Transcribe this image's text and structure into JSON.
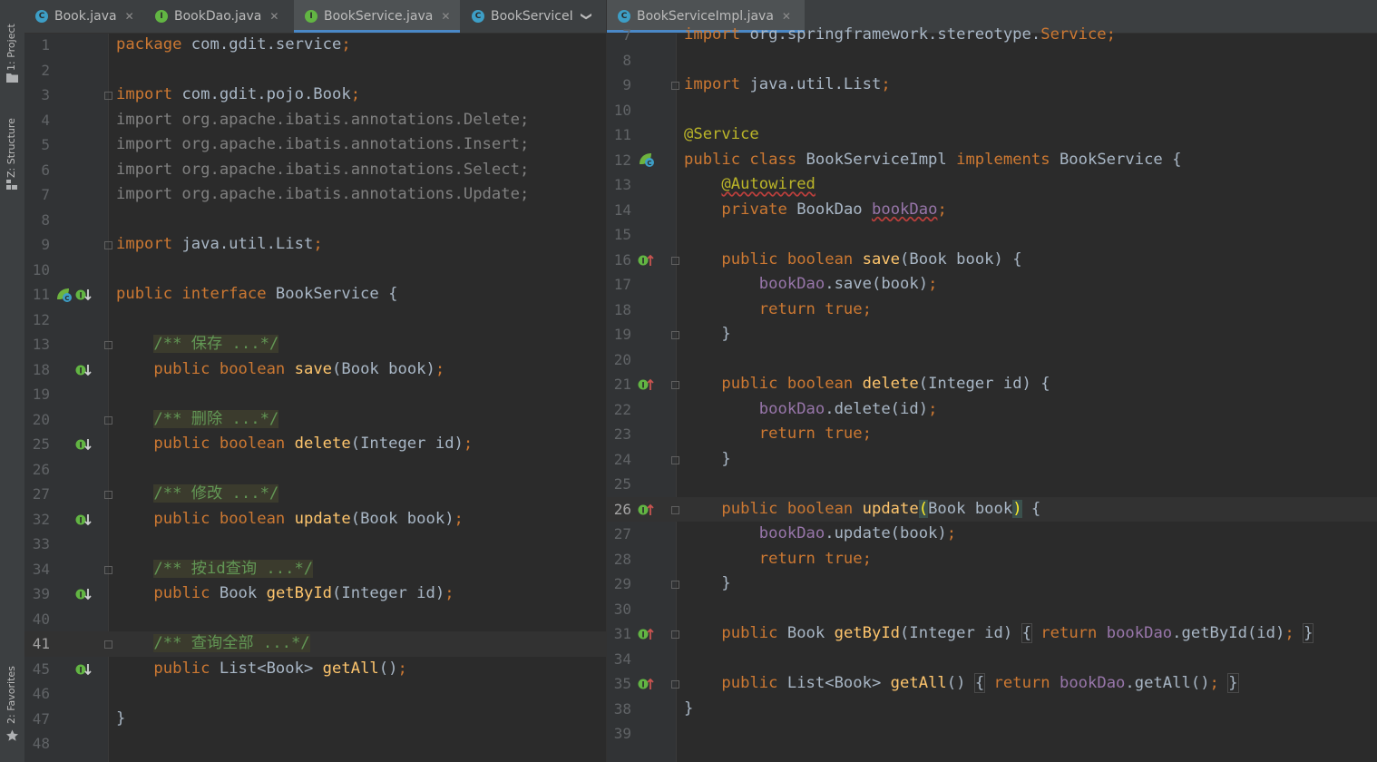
{
  "toolwindows": {
    "project": "1: Project",
    "structure": "Z: Structure",
    "favorites": "2: Favorites"
  },
  "left_tabs": [
    {
      "label": "Book.java",
      "kind": "C"
    },
    {
      "label": "BookDao.java",
      "kind": "I"
    },
    {
      "label": "BookService.java",
      "kind": "I"
    },
    {
      "label": "BookServiceI",
      "kind": "C"
    }
  ],
  "right_tabs": [
    {
      "label": "BookServiceImpl.java",
      "kind": "C"
    }
  ],
  "left_lines": [
    {
      "n": "1",
      "t": [
        [
          "kw",
          "package "
        ],
        [
          "",
          "com.gdit.service"
        ],
        [
          "kw",
          ";"
        ]
      ]
    },
    {
      "n": "2",
      "t": []
    },
    {
      "n": "3",
      "t": [
        [
          "kw",
          "import "
        ],
        [
          "",
          "com.gdit.pojo.Book"
        ],
        [
          "kw",
          ";"
        ]
      ]
    },
    {
      "n": "4",
      "t": [
        [
          "gray",
          "import org.apache.ibatis.annotations.Delete;"
        ]
      ]
    },
    {
      "n": "5",
      "t": [
        [
          "gray",
          "import org.apache.ibatis.annotations.Insert;"
        ]
      ]
    },
    {
      "n": "6",
      "t": [
        [
          "gray",
          "import org.apache.ibatis.annotations.Select;"
        ]
      ]
    },
    {
      "n": "7",
      "t": [
        [
          "gray",
          "import org.apache.ibatis.annotations.Update;"
        ]
      ]
    },
    {
      "n": "8",
      "t": []
    },
    {
      "n": "9",
      "t": [
        [
          "kw",
          "import "
        ],
        [
          "",
          "java.util.List"
        ],
        [
          "kw",
          ";"
        ]
      ]
    },
    {
      "n": "10",
      "t": []
    },
    {
      "n": "11",
      "t": [
        [
          "kw",
          "public interface "
        ],
        [
          "",
          "BookService {"
        ]
      ]
    },
    {
      "n": "12",
      "t": []
    },
    {
      "n": "13",
      "t": [
        [
          "",
          "    "
        ],
        [
          "doc",
          "/** 保存 ...*/"
        ]
      ]
    },
    {
      "n": "18",
      "t": [
        [
          "",
          "    "
        ],
        [
          "kw",
          "public boolean "
        ],
        [
          "fn",
          "save"
        ],
        [
          "",
          "(Book book)"
        ],
        [
          "kw",
          ";"
        ]
      ]
    },
    {
      "n": "19",
      "t": []
    },
    {
      "n": "20",
      "t": [
        [
          "",
          "    "
        ],
        [
          "doc",
          "/** 删除 ...*/"
        ]
      ]
    },
    {
      "n": "25",
      "t": [
        [
          "",
          "    "
        ],
        [
          "kw",
          "public boolean "
        ],
        [
          "fn",
          "delete"
        ],
        [
          "",
          "(Integer id)"
        ],
        [
          "kw",
          ";"
        ]
      ]
    },
    {
      "n": "26",
      "t": []
    },
    {
      "n": "27",
      "t": [
        [
          "",
          "    "
        ],
        [
          "doc",
          "/** 修改 ...*/"
        ]
      ]
    },
    {
      "n": "32",
      "t": [
        [
          "",
          "    "
        ],
        [
          "kw",
          "public boolean "
        ],
        [
          "fn",
          "update"
        ],
        [
          "",
          "(Book book)"
        ],
        [
          "kw",
          ";"
        ]
      ]
    },
    {
      "n": "33",
      "t": []
    },
    {
      "n": "34",
      "t": [
        [
          "",
          "    "
        ],
        [
          "doc",
          "/** 按id查询 ...*/"
        ]
      ]
    },
    {
      "n": "39",
      "t": [
        [
          "",
          "    "
        ],
        [
          "kw",
          "public "
        ],
        [
          "",
          "Book "
        ],
        [
          "fn",
          "getById"
        ],
        [
          "",
          "(Integer id)"
        ],
        [
          "kw",
          ";"
        ]
      ]
    },
    {
      "n": "40",
      "t": []
    },
    {
      "n": "41",
      "t": [
        [
          "",
          "    "
        ],
        [
          "doc",
          "/** 查询全部 ...*/"
        ]
      ]
    },
    {
      "n": "45",
      "t": [
        [
          "",
          "    "
        ],
        [
          "kw",
          "public "
        ],
        [
          "",
          "List<Book> "
        ],
        [
          "fn",
          "getAll"
        ],
        [
          "",
          "()"
        ],
        [
          "kw",
          ";"
        ]
      ]
    },
    {
      "n": "46",
      "t": []
    },
    {
      "n": "47",
      "t": [
        [
          "",
          "}"
        ]
      ]
    },
    {
      "n": "48",
      "t": []
    }
  ],
  "right_lines": [
    {
      "n": "7",
      "t": [
        [
          "kw",
          "import "
        ],
        [
          "",
          "org.springframework.stereotype."
        ],
        [
          "kw",
          "Service;"
        ]
      ]
    },
    {
      "n": "8",
      "t": []
    },
    {
      "n": "9",
      "t": [
        [
          "kw",
          "import "
        ],
        [
          "",
          "java.util.List"
        ],
        [
          "kw",
          ";"
        ]
      ]
    },
    {
      "n": "10",
      "t": []
    },
    {
      "n": "11",
      "t": [
        [
          "an",
          "@Service"
        ]
      ]
    },
    {
      "n": "12",
      "t": [
        [
          "kw",
          "public class "
        ],
        [
          "",
          "BookServiceImpl "
        ],
        [
          "kw",
          "implements "
        ],
        [
          "",
          "BookService {"
        ]
      ]
    },
    {
      "n": "13",
      "t": [
        [
          "",
          "    "
        ],
        [
          "an squig",
          "@Autowired"
        ]
      ]
    },
    {
      "n": "14",
      "t": [
        [
          "",
          "    "
        ],
        [
          "kw",
          "private "
        ],
        [
          "",
          "BookDao "
        ],
        [
          "fld squig",
          "bookDao"
        ],
        [
          "kw",
          ";"
        ]
      ]
    },
    {
      "n": "15",
      "t": []
    },
    {
      "n": "16",
      "t": [
        [
          "",
          "    "
        ],
        [
          "kw",
          "public boolean "
        ],
        [
          "fn",
          "save"
        ],
        [
          "",
          "(Book book) {"
        ]
      ]
    },
    {
      "n": "17",
      "t": [
        [
          "",
          "        "
        ],
        [
          "fld",
          "bookDao"
        ],
        [
          "",
          ".save(book)"
        ],
        [
          "kw",
          ";"
        ]
      ]
    },
    {
      "n": "18",
      "t": [
        [
          "",
          "        "
        ],
        [
          "kw",
          "return true;"
        ]
      ]
    },
    {
      "n": "19",
      "t": [
        [
          "",
          "    }"
        ]
      ]
    },
    {
      "n": "20",
      "t": []
    },
    {
      "n": "21",
      "t": [
        [
          "",
          "    "
        ],
        [
          "kw",
          "public boolean "
        ],
        [
          "fn",
          "delete"
        ],
        [
          "",
          "(Integer id) {"
        ]
      ]
    },
    {
      "n": "22",
      "t": [
        [
          "",
          "        "
        ],
        [
          "fld",
          "bookDao"
        ],
        [
          "",
          ".delete(id)"
        ],
        [
          "kw",
          ";"
        ]
      ]
    },
    {
      "n": "23",
      "t": [
        [
          "",
          "        "
        ],
        [
          "kw",
          "return true;"
        ]
      ]
    },
    {
      "n": "24",
      "t": [
        [
          "",
          "    }"
        ]
      ]
    },
    {
      "n": "25",
      "t": []
    },
    {
      "n": "26",
      "t": [
        [
          "",
          "    "
        ],
        [
          "kw",
          "public boolean "
        ],
        [
          "fn",
          "update"
        ],
        [
          "bm",
          "("
        ],
        [
          "",
          "Book book"
        ],
        [
          "bm",
          ")"
        ],
        [
          "",
          " {"
        ]
      ]
    },
    {
      "n": "27",
      "t": [
        [
          "",
          "        "
        ],
        [
          "fld",
          "bookDao"
        ],
        [
          "",
          ".update(book)"
        ],
        [
          "kw",
          ";"
        ]
      ]
    },
    {
      "n": "28",
      "t": [
        [
          "",
          "        "
        ],
        [
          "kw",
          "return true;"
        ]
      ]
    },
    {
      "n": "29",
      "t": [
        [
          "",
          "    }"
        ]
      ]
    },
    {
      "n": "30",
      "t": []
    },
    {
      "n": "31",
      "t": [
        [
          "",
          "    "
        ],
        [
          "kw",
          "public "
        ],
        [
          "",
          "Book "
        ],
        [
          "fn",
          "getById"
        ],
        [
          "",
          "(Integer id) "
        ],
        [
          "brace",
          "{"
        ],
        [
          "",
          " "
        ],
        [
          "kw",
          "return "
        ],
        [
          "fld",
          "bookDao"
        ],
        [
          "",
          ".getById(id)"
        ],
        [
          "kw",
          ";"
        ],
        [
          "",
          " "
        ],
        [
          "brace",
          "}"
        ]
      ]
    },
    {
      "n": "34",
      "t": []
    },
    {
      "n": "35",
      "t": [
        [
          "",
          "    "
        ],
        [
          "kw",
          "public "
        ],
        [
          "",
          "List<Book> "
        ],
        [
          "fn",
          "getAll"
        ],
        [
          "",
          "() "
        ],
        [
          "brace",
          "{"
        ],
        [
          "",
          " "
        ],
        [
          "kw",
          "return "
        ],
        [
          "fld",
          "bookDao"
        ],
        [
          "",
          ".getAll()"
        ],
        [
          "kw",
          ";"
        ],
        [
          "",
          " "
        ],
        [
          "brace",
          "}"
        ]
      ]
    },
    {
      "n": "38",
      "t": [
        [
          "",
          "}"
        ]
      ]
    },
    {
      "n": "39",
      "t": []
    }
  ]
}
